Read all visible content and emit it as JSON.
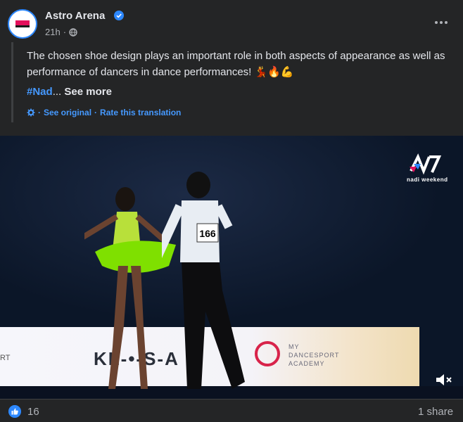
{
  "post": {
    "page_name": "Astro Arena",
    "time": "21h",
    "text": "The chosen shoe design plays an important role in both aspects of appearance as well as performance of dancers in dance performances! 💃🔥💪",
    "hashtag": "#Nad",
    "ellipsis": "...",
    "see_more": "See more",
    "translation": {
      "see_original": "See original",
      "rate": "Rate this translation",
      "sep": "·"
    }
  },
  "video": {
    "watermark": "nadi weekend",
    "banner_text_left": "RT",
    "banner_brand": "KL-•-S-A",
    "academy_lines": [
      "MY",
      "DANCESPORT",
      "ACADEMY"
    ],
    "bib_number": "166"
  },
  "footer": {
    "likes": "16",
    "shares": "1 share"
  },
  "colors": {
    "accent": "#2d88ff",
    "link": "#4599ff",
    "bg": "#242526"
  }
}
